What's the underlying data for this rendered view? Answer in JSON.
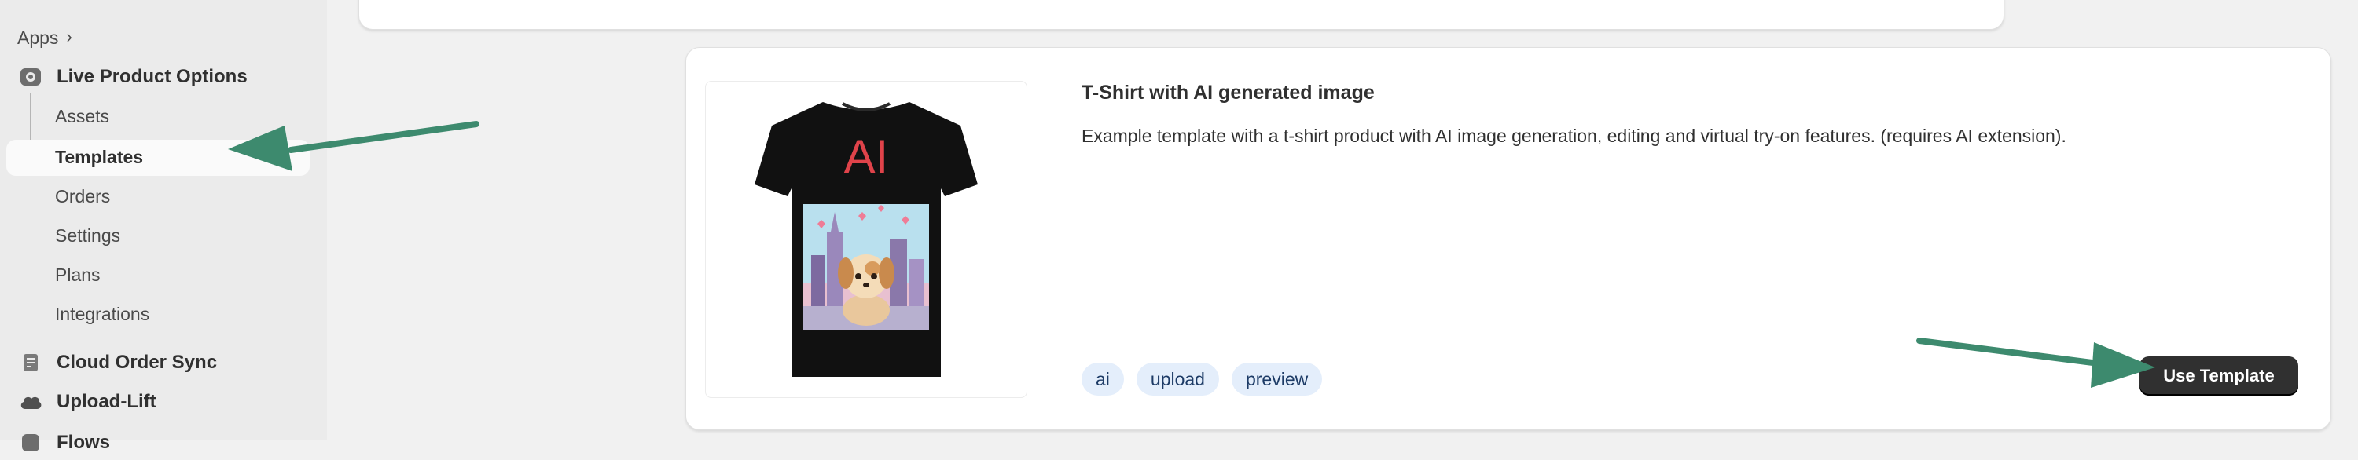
{
  "sidebar": {
    "breadcrumb": {
      "label": "Apps",
      "chevron": "›"
    },
    "apps": [
      {
        "label": "Live Product Options",
        "icon": "live-product-options-icon"
      },
      {
        "label": "Cloud Order Sync",
        "icon": "cloud-order-sync-icon"
      },
      {
        "label": "Upload-Lift",
        "icon": "upload-lift-icon"
      },
      {
        "label": "Flows",
        "icon": "flows-icon"
      }
    ],
    "subitems": [
      {
        "label": "Assets"
      },
      {
        "label": "Templates",
        "selected": true
      },
      {
        "label": "Orders"
      },
      {
        "label": "Settings"
      },
      {
        "label": "Plans"
      },
      {
        "label": "Integrations"
      }
    ]
  },
  "template_card": {
    "title": "T-Shirt with AI generated image",
    "description": "Example template with a t-shirt product with AI image generation, editing and virtual try-on features. (requires AI extension).",
    "image_text": "AI",
    "tags": [
      "ai",
      "upload",
      "preview"
    ],
    "use_button": "Use Template"
  },
  "colors": {
    "sidebar_bg": "#ebebeb",
    "page_bg": "#f1f1f1",
    "button_bg": "#303030",
    "tag_bg": "#e4eefb",
    "annotation_arrow": "#3d8a6e",
    "shirt": "#111111",
    "ai_text": "#e0434a"
  }
}
